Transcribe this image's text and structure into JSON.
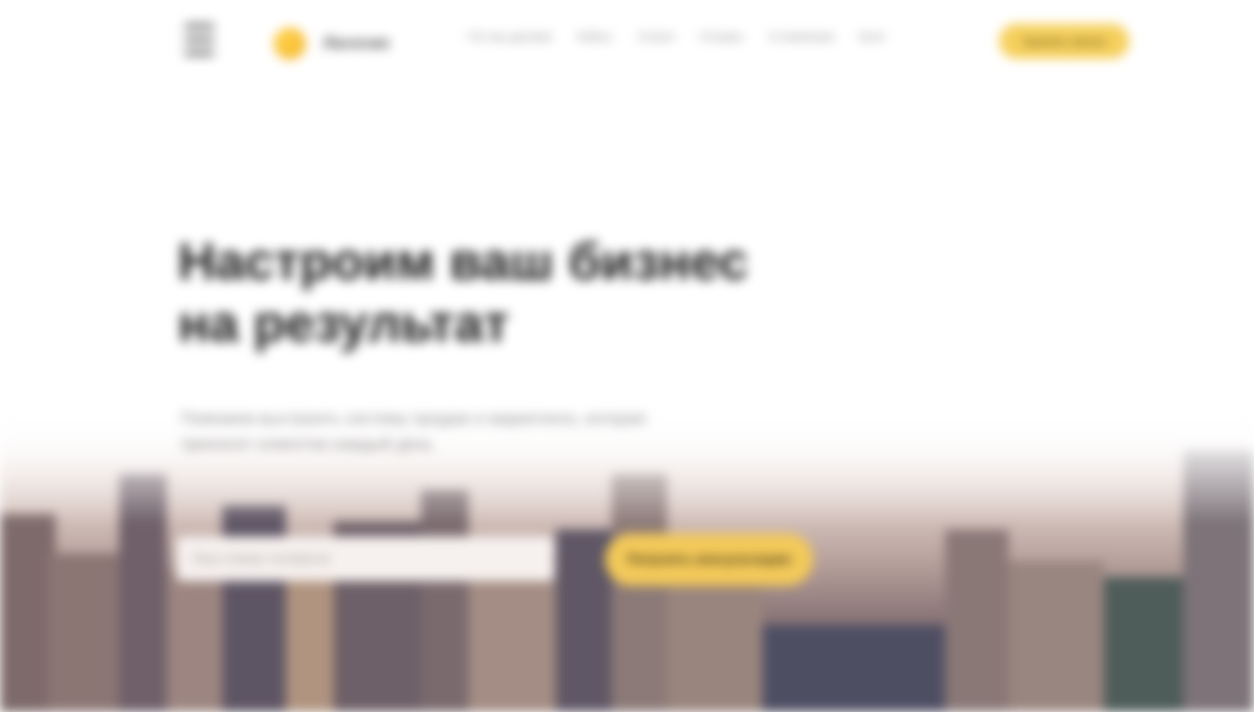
{
  "header": {
    "logo_text": "Логотип",
    "nav": [
      {
        "label": "Что мы делаем"
      },
      {
        "label": "Кейсы"
      },
      {
        "label": "Услуги"
      },
      {
        "label": "Отзывы"
      },
      {
        "label": "О компании"
      },
      {
        "label": "Блог"
      }
    ],
    "cta_label": "Заказать звонок"
  },
  "hero": {
    "title_line_1": "Настроим ваш бизнес",
    "title_line_2": "на результат",
    "subtitle": "Поможем выстроить систему продаж и маркетинга, которая приносит клиентов каждый день",
    "input_placeholder": "Ваш номер телефона",
    "cta_label": "Получить консультацию"
  },
  "colors": {
    "accent": "#f3c95a",
    "title": "#1c1c1c",
    "nav_text": "#8a8a8a"
  },
  "icons": {
    "menu": "menu-icon",
    "logo": "logo-mark-icon"
  }
}
